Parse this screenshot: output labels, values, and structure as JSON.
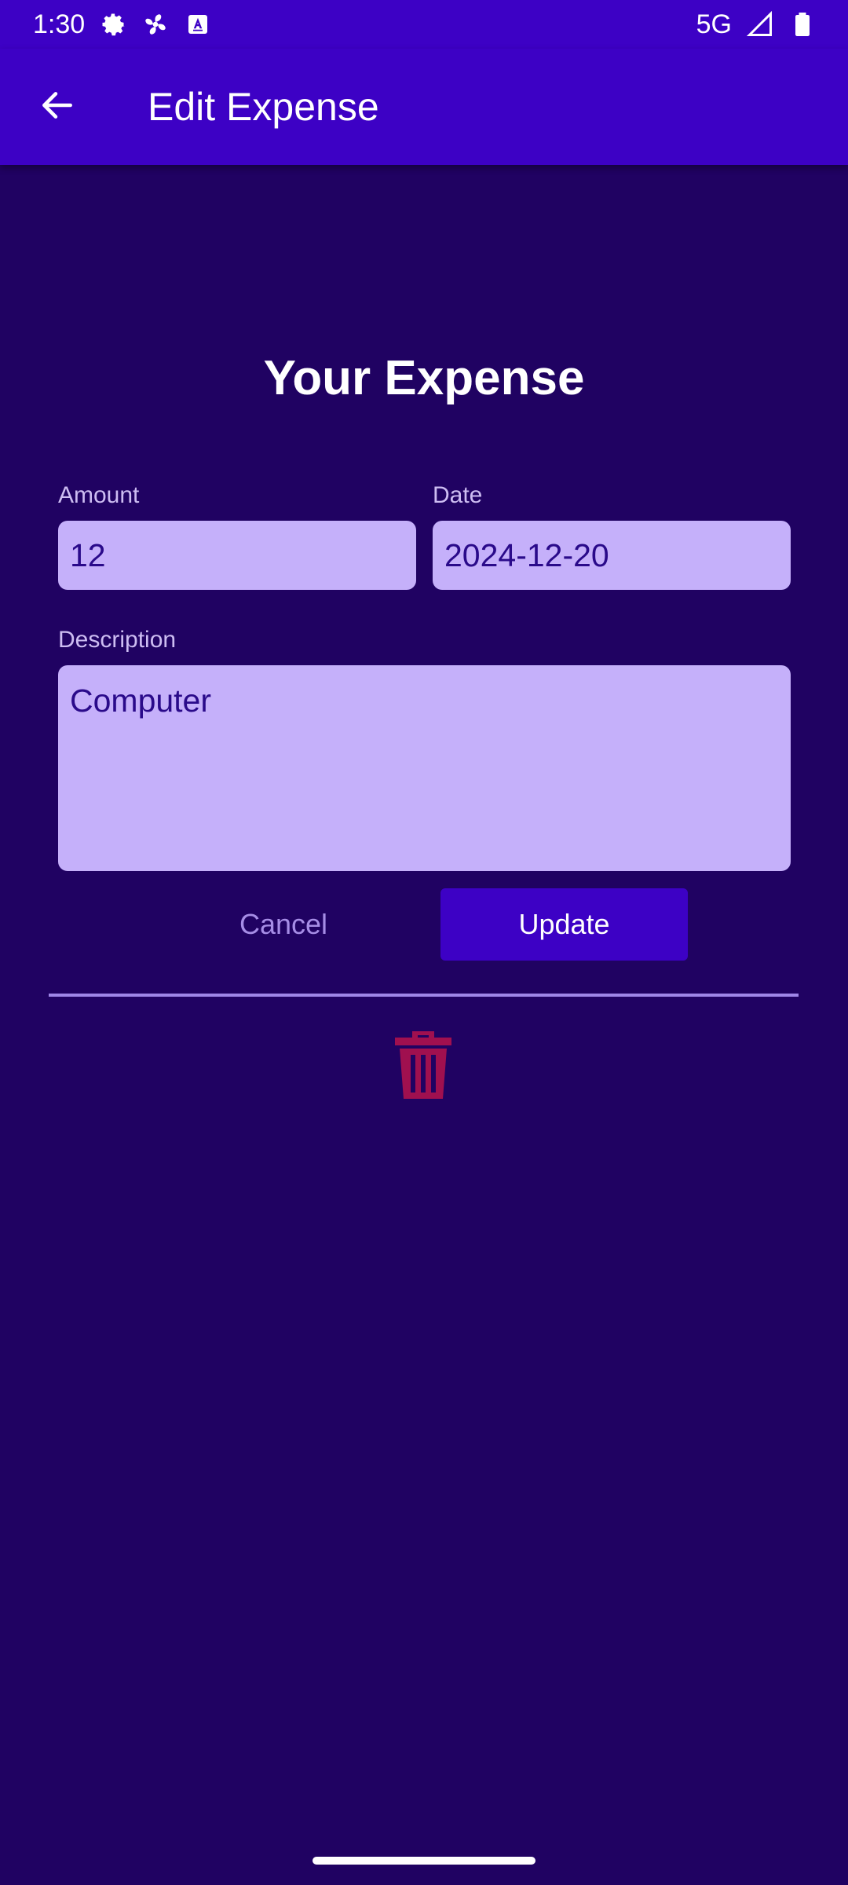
{
  "status_bar": {
    "time": "1:30",
    "network": "5G",
    "icons": [
      "settings-icon",
      "fan-icon",
      "text-icon",
      "signal-icon",
      "battery-icon"
    ]
  },
  "app_bar": {
    "title": "Edit Expense",
    "back_icon": "arrow-back-icon"
  },
  "form": {
    "heading": "Your Expense",
    "amount": {
      "label": "Amount",
      "value": "12"
    },
    "date": {
      "label": "Date",
      "value": "2024-12-20"
    },
    "description": {
      "label": "Description",
      "value": "Computer"
    },
    "cancel_label": "Cancel",
    "update_label": "Update",
    "delete_icon": "trash-icon"
  },
  "colors": {
    "app_bar": "#3d01c5",
    "background": "#200262",
    "field": "#c5b0fa",
    "field_text": "#2a0a8a",
    "delete": "#a0104f",
    "divider": "#9f86e8"
  }
}
